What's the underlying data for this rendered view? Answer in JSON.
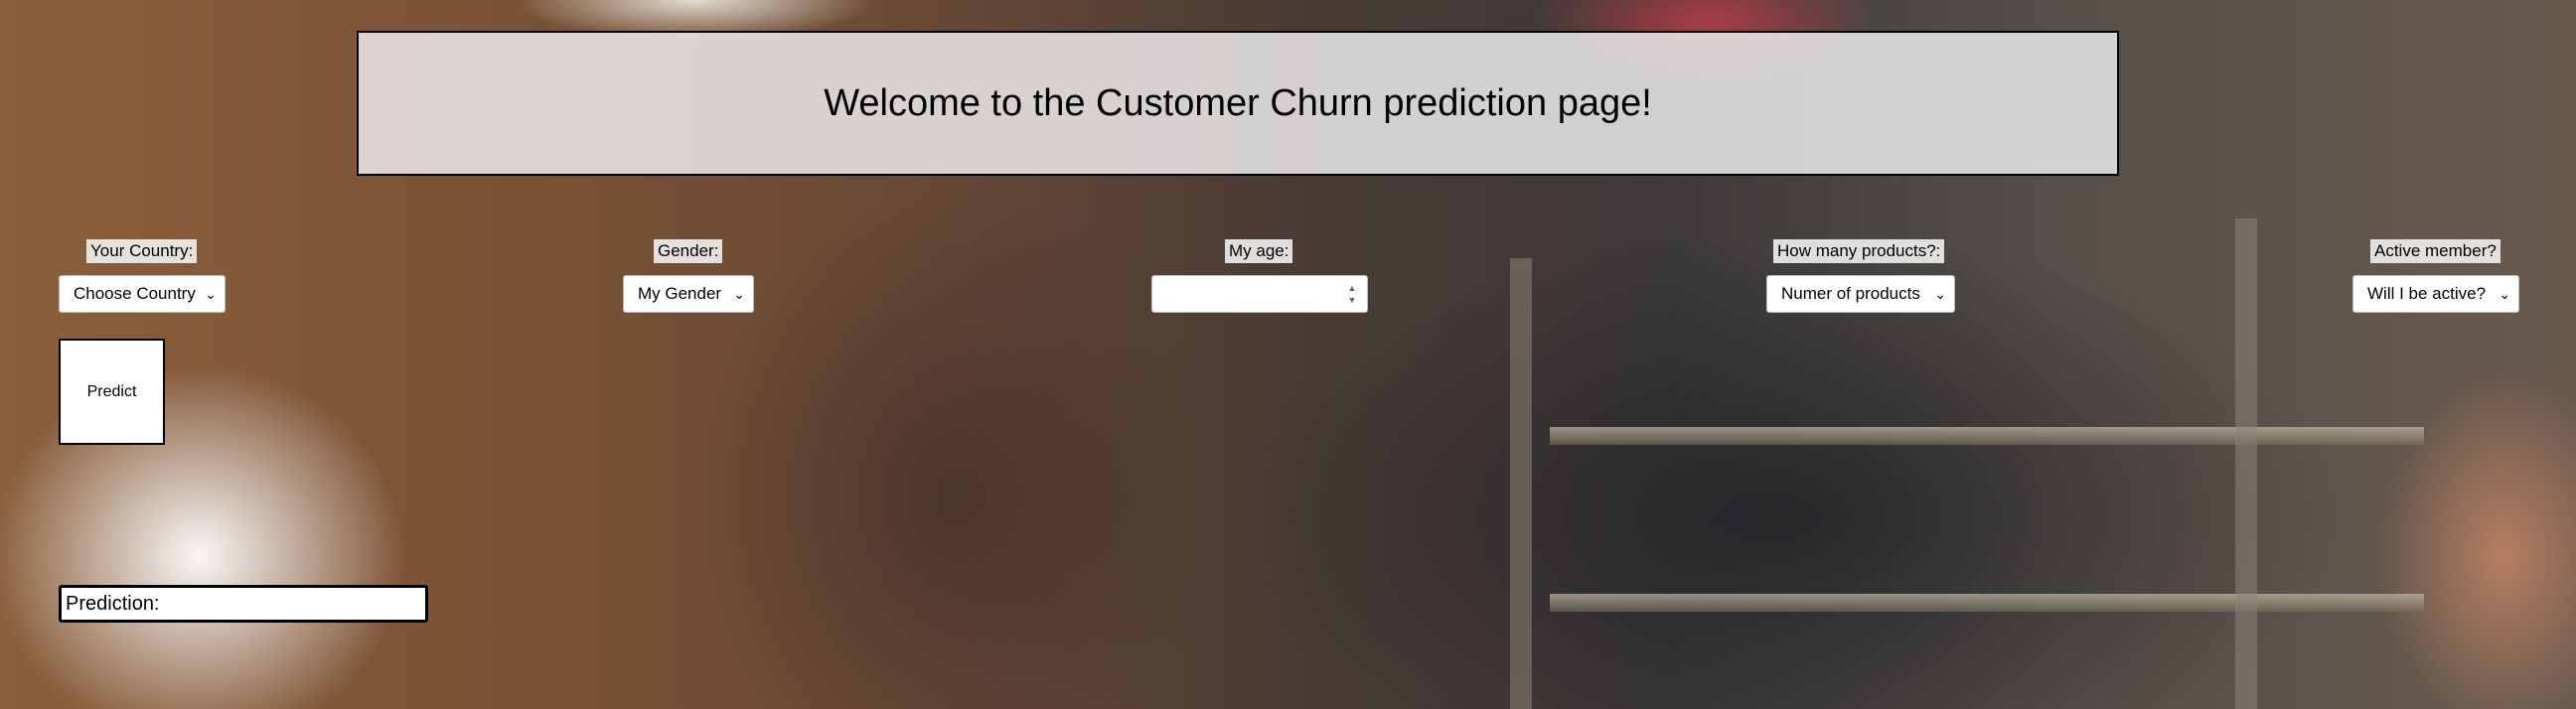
{
  "header": {
    "title": "Welcome to the Customer Churn prediction page!"
  },
  "form": {
    "country": {
      "label": "Your Country:",
      "selected": "Choose Country"
    },
    "gender": {
      "label": "Gender:",
      "selected": "My Gender"
    },
    "age": {
      "label": "My age:",
      "value": ""
    },
    "products": {
      "label": "How many products?:",
      "selected": "Numer of products"
    },
    "active": {
      "label": "Active member?",
      "selected": "Will I be active?"
    },
    "predict_label": "Predict",
    "prediction_label": "Prediction:"
  },
  "icons": {
    "dropdown": "chevron-down-icon",
    "spinner": "spinner-arrows-icon"
  },
  "colors": {
    "border": "#000000",
    "title_bg": "#ebebeb",
    "input_bg": "#ffffff"
  }
}
